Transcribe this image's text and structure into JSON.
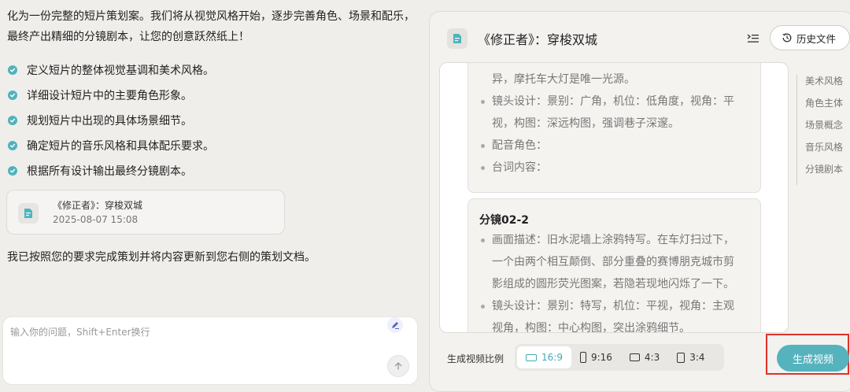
{
  "chat": {
    "intro": "化为一份完整的短片策划案。我们将从视觉风格开始，逐步完善角色、场景和配乐，最终产出精细的分镜剧本，让您的创意跃然纸上！",
    "steps": [
      "定义短片的整体视觉基调和美术风格。",
      "详细设计短片中的主要角色形象。",
      "规划短片中出现的具体场景细节。",
      "确定短片的音乐风格和具体配乐要求。",
      "根据所有设计输出最终分镜剧本。"
    ],
    "doc_card": {
      "title": "《修正者》：穿梭双城",
      "timestamp": "2025-08-07 15:08"
    },
    "reply": "我已按照您的要求完成策划并将内容更新到您右侧的策划文档。",
    "input": {
      "placeholder": "输入你的问题，Shift+Enter换行",
      "value": ""
    }
  },
  "document": {
    "title": "《修正者》：穿梭双城",
    "history_label": "历史文件",
    "shot1": {
      "lines": [
        {
          "text": "异，摩托车大灯是唯一光源。",
          "bullet": false
        },
        {
          "text": "镜头设计：景别：广角，机位：低角度，视角：平",
          "bullet": true
        },
        {
          "text": "视，构图：深远构图，强调巷子深邃。",
          "bullet": false
        },
        {
          "text": "配音角色：",
          "bullet": true
        },
        {
          "text": "台词内容：",
          "bullet": true
        }
      ]
    },
    "shot2": {
      "heading": "分镜02-2",
      "lines": [
        {
          "text": "画面描述：旧水泥墙上涂鸦特写。在车灯扫过下，",
          "bullet": true
        },
        {
          "text": "一个由两个相互颠倒、部分重叠的赛博朋克城市剪",
          "bullet": false
        },
        {
          "text": "影组成的圆形荧光图案，若隐若现地闪烁了一下。",
          "bullet": false
        },
        {
          "text": "镜头设计：景别：特写，机位：平视，视角：主观",
          "bullet": true
        },
        {
          "text": "视角，构图：中心构图，突出涂鸦细节。",
          "bullet": false
        }
      ]
    },
    "outline": [
      "美术风格",
      "角色主体",
      "场景概念",
      "音乐风格",
      "分镜剧本"
    ],
    "ratio_label": "生成视频比例",
    "ratios": [
      {
        "label": "16:9",
        "active": true
      },
      {
        "label": "9:16",
        "active": false
      },
      {
        "label": "4:3",
        "active": false
      },
      {
        "label": "3:4",
        "active": false
      }
    ],
    "generate_label": "生成视频"
  },
  "colors": {
    "accent": "#55b3be",
    "highlight": "#e0302b",
    "background": "#efeeeb"
  }
}
